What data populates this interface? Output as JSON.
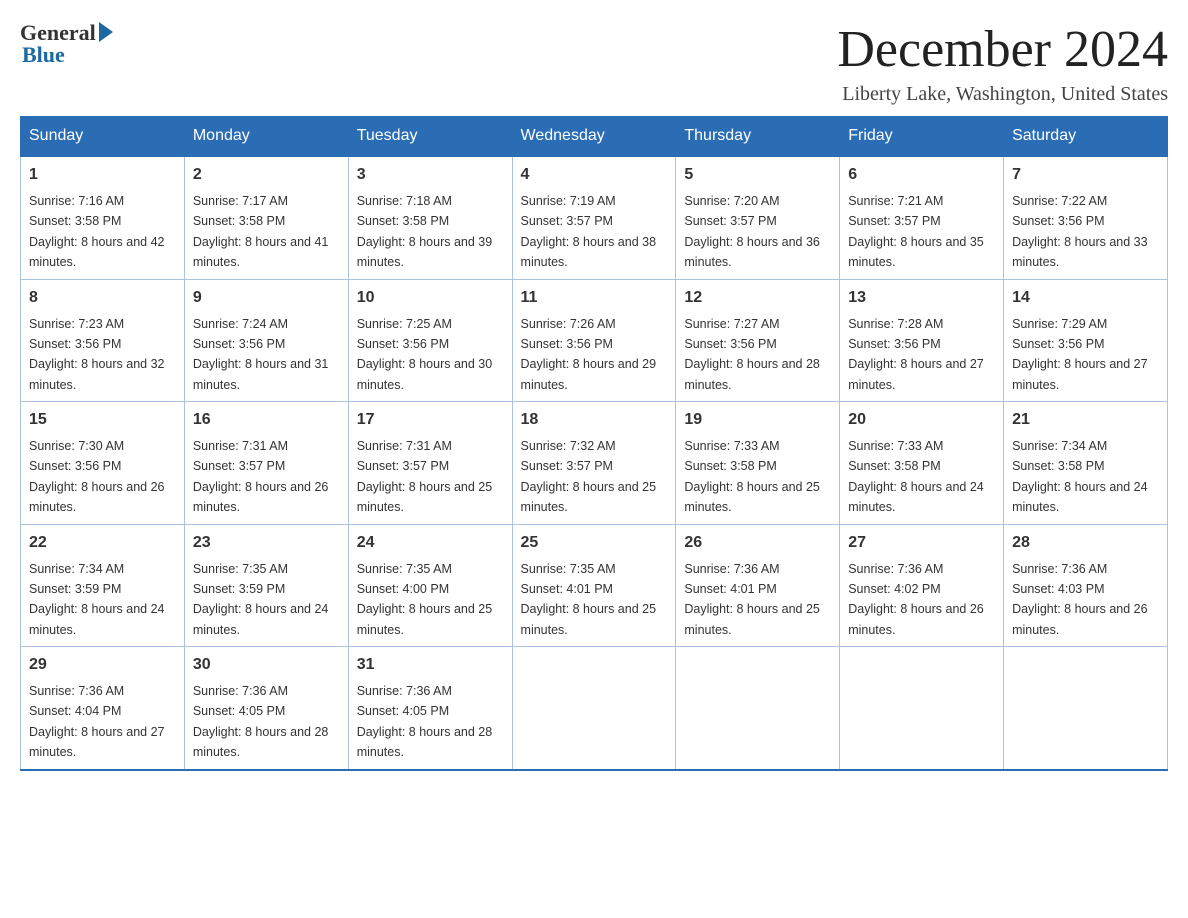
{
  "logo": {
    "general": "General",
    "blue": "Blue"
  },
  "title": "December 2024",
  "subtitle": "Liberty Lake, Washington, United States",
  "days_of_week": [
    "Sunday",
    "Monday",
    "Tuesday",
    "Wednesday",
    "Thursday",
    "Friday",
    "Saturday"
  ],
  "weeks": [
    [
      {
        "day": "1",
        "sunrise": "7:16 AM",
        "sunset": "3:58 PM",
        "daylight": "8 hours and 42 minutes."
      },
      {
        "day": "2",
        "sunrise": "7:17 AM",
        "sunset": "3:58 PM",
        "daylight": "8 hours and 41 minutes."
      },
      {
        "day": "3",
        "sunrise": "7:18 AM",
        "sunset": "3:58 PM",
        "daylight": "8 hours and 39 minutes."
      },
      {
        "day": "4",
        "sunrise": "7:19 AM",
        "sunset": "3:57 PM",
        "daylight": "8 hours and 38 minutes."
      },
      {
        "day": "5",
        "sunrise": "7:20 AM",
        "sunset": "3:57 PM",
        "daylight": "8 hours and 36 minutes."
      },
      {
        "day": "6",
        "sunrise": "7:21 AM",
        "sunset": "3:57 PM",
        "daylight": "8 hours and 35 minutes."
      },
      {
        "day": "7",
        "sunrise": "7:22 AM",
        "sunset": "3:56 PM",
        "daylight": "8 hours and 33 minutes."
      }
    ],
    [
      {
        "day": "8",
        "sunrise": "7:23 AM",
        "sunset": "3:56 PM",
        "daylight": "8 hours and 32 minutes."
      },
      {
        "day": "9",
        "sunrise": "7:24 AM",
        "sunset": "3:56 PM",
        "daylight": "8 hours and 31 minutes."
      },
      {
        "day": "10",
        "sunrise": "7:25 AM",
        "sunset": "3:56 PM",
        "daylight": "8 hours and 30 minutes."
      },
      {
        "day": "11",
        "sunrise": "7:26 AM",
        "sunset": "3:56 PM",
        "daylight": "8 hours and 29 minutes."
      },
      {
        "day": "12",
        "sunrise": "7:27 AM",
        "sunset": "3:56 PM",
        "daylight": "8 hours and 28 minutes."
      },
      {
        "day": "13",
        "sunrise": "7:28 AM",
        "sunset": "3:56 PM",
        "daylight": "8 hours and 27 minutes."
      },
      {
        "day": "14",
        "sunrise": "7:29 AM",
        "sunset": "3:56 PM",
        "daylight": "8 hours and 27 minutes."
      }
    ],
    [
      {
        "day": "15",
        "sunrise": "7:30 AM",
        "sunset": "3:56 PM",
        "daylight": "8 hours and 26 minutes."
      },
      {
        "day": "16",
        "sunrise": "7:31 AM",
        "sunset": "3:57 PM",
        "daylight": "8 hours and 26 minutes."
      },
      {
        "day": "17",
        "sunrise": "7:31 AM",
        "sunset": "3:57 PM",
        "daylight": "8 hours and 25 minutes."
      },
      {
        "day": "18",
        "sunrise": "7:32 AM",
        "sunset": "3:57 PM",
        "daylight": "8 hours and 25 minutes."
      },
      {
        "day": "19",
        "sunrise": "7:33 AM",
        "sunset": "3:58 PM",
        "daylight": "8 hours and 25 minutes."
      },
      {
        "day": "20",
        "sunrise": "7:33 AM",
        "sunset": "3:58 PM",
        "daylight": "8 hours and 24 minutes."
      },
      {
        "day": "21",
        "sunrise": "7:34 AM",
        "sunset": "3:58 PM",
        "daylight": "8 hours and 24 minutes."
      }
    ],
    [
      {
        "day": "22",
        "sunrise": "7:34 AM",
        "sunset": "3:59 PM",
        "daylight": "8 hours and 24 minutes."
      },
      {
        "day": "23",
        "sunrise": "7:35 AM",
        "sunset": "3:59 PM",
        "daylight": "8 hours and 24 minutes."
      },
      {
        "day": "24",
        "sunrise": "7:35 AM",
        "sunset": "4:00 PM",
        "daylight": "8 hours and 25 minutes."
      },
      {
        "day": "25",
        "sunrise": "7:35 AM",
        "sunset": "4:01 PM",
        "daylight": "8 hours and 25 minutes."
      },
      {
        "day": "26",
        "sunrise": "7:36 AM",
        "sunset": "4:01 PM",
        "daylight": "8 hours and 25 minutes."
      },
      {
        "day": "27",
        "sunrise": "7:36 AM",
        "sunset": "4:02 PM",
        "daylight": "8 hours and 26 minutes."
      },
      {
        "day": "28",
        "sunrise": "7:36 AM",
        "sunset": "4:03 PM",
        "daylight": "8 hours and 26 minutes."
      }
    ],
    [
      {
        "day": "29",
        "sunrise": "7:36 AM",
        "sunset": "4:04 PM",
        "daylight": "8 hours and 27 minutes."
      },
      {
        "day": "30",
        "sunrise": "7:36 AM",
        "sunset": "4:05 PM",
        "daylight": "8 hours and 28 minutes."
      },
      {
        "day": "31",
        "sunrise": "7:36 AM",
        "sunset": "4:05 PM",
        "daylight": "8 hours and 28 minutes."
      },
      null,
      null,
      null,
      null
    ]
  ],
  "labels": {
    "sunrise": "Sunrise:",
    "sunset": "Sunset:",
    "daylight": "Daylight:"
  }
}
